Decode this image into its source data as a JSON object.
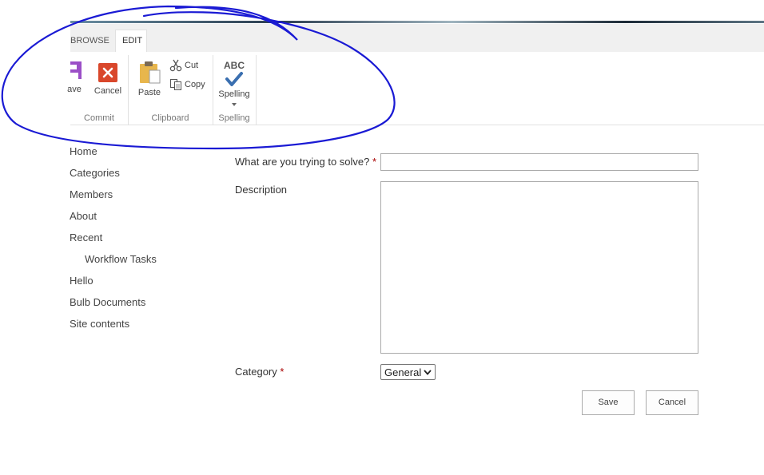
{
  "ribbon": {
    "tabs": [
      {
        "label": "BROWSE"
      },
      {
        "label": "EDIT"
      }
    ],
    "commit": {
      "group_label": "Commit",
      "save_label": "ave",
      "cancel_label": "Cancel"
    },
    "clipboard": {
      "group_label": "Clipboard",
      "paste_label": "Paste",
      "cut_label": "Cut",
      "copy_label": "Copy"
    },
    "spelling": {
      "group_label": "Spelling",
      "button_label": "Spelling",
      "icon_text": "ABC"
    }
  },
  "nav": {
    "items": [
      {
        "label": "Home"
      },
      {
        "label": "Categories"
      },
      {
        "label": "Members"
      },
      {
        "label": "About"
      },
      {
        "label": "Recent"
      },
      {
        "label": "Workflow Tasks"
      },
      {
        "label": "Hello"
      },
      {
        "label": "Bulb Documents"
      },
      {
        "label": "Site contents"
      }
    ]
  },
  "form": {
    "question_label": "What are you trying to solve?",
    "required_marker": "*",
    "question_value": "",
    "description_label": "Description",
    "description_value": "",
    "category_label": "Category",
    "category_selected": "General",
    "save_label": "Save",
    "cancel_label": "Cancel"
  },
  "colors": {
    "annotation_stroke": "#1a1ad4",
    "cancel_icon_bg": "#d9472b",
    "save_icon": "#9b4fc7",
    "paste_icon": "#e8b64c",
    "check_icon": "#3a6fb0"
  }
}
